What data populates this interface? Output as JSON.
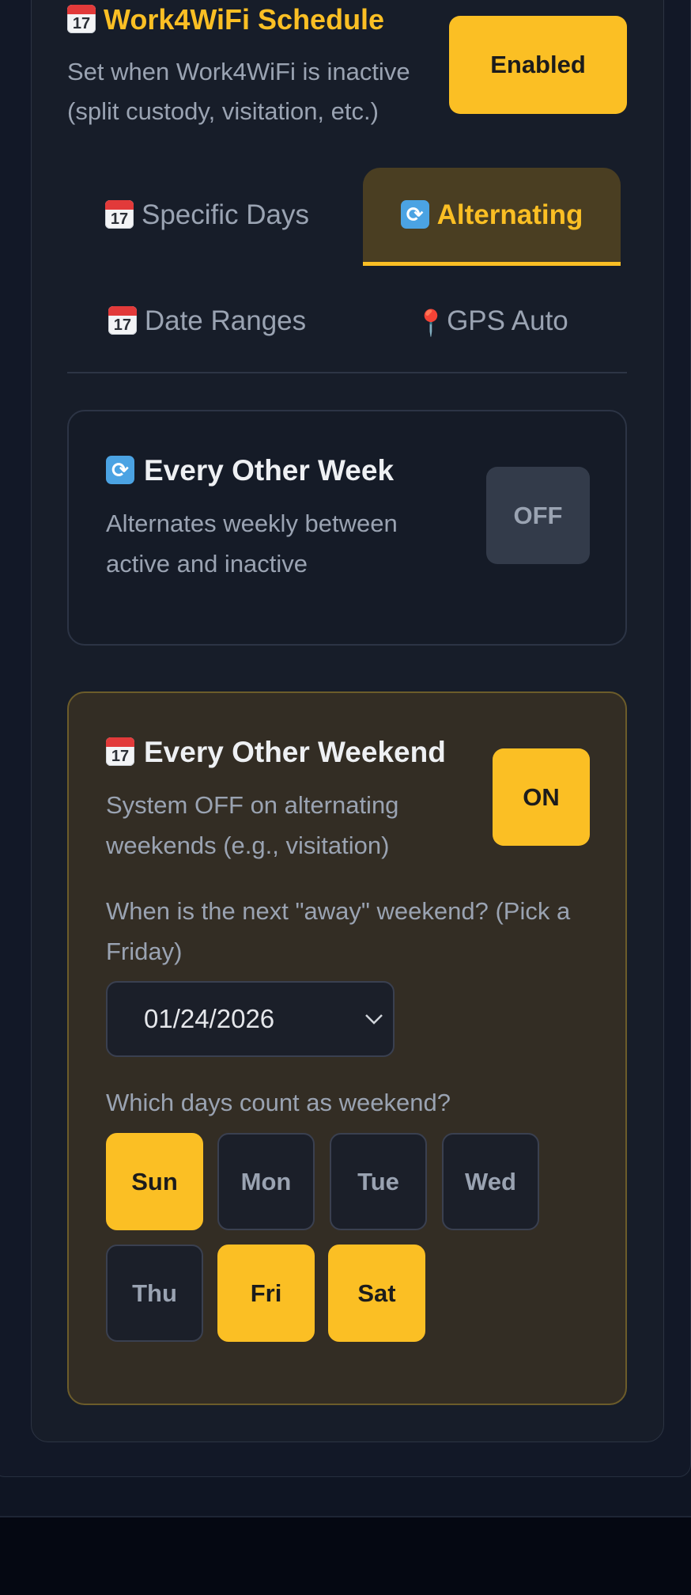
{
  "header": {
    "title": "Work4WiFi Schedule",
    "title_icon": "calendar-icon",
    "subtitle": "Set when Work4WiFi is inactive (split custody, visitation, etc.)",
    "status_button": "Enabled"
  },
  "tabs": [
    {
      "label": "Specific Days",
      "icon": "calendar-icon",
      "active": false
    },
    {
      "label": "Alternating",
      "icon": "sync-icon",
      "active": true
    },
    {
      "label": "Date Ranges",
      "icon": "calendar-icon",
      "active": false
    },
    {
      "label": "GPS Auto",
      "icon": "pin-icon",
      "active": false
    }
  ],
  "every_other_week": {
    "title": "Every Other Week",
    "icon": "sync-icon",
    "description": "Alternates weekly between active and inactive",
    "toggle": "OFF"
  },
  "every_other_weekend": {
    "title": "Every Other Weekend",
    "icon": "calendar-icon",
    "description": "System OFF on alternating weekends (e.g., visitation)",
    "toggle": "ON",
    "next_away_label": "When is the next \"away\" weekend? (Pick a Friday)",
    "next_away_value": "01/24/2026",
    "days_label": "Which days count as weekend?",
    "days": [
      {
        "label": "Sun",
        "selected": true
      },
      {
        "label": "Mon",
        "selected": false
      },
      {
        "label": "Tue",
        "selected": false
      },
      {
        "label": "Wed",
        "selected": false
      },
      {
        "label": "Thu",
        "selected": false
      },
      {
        "label": "Fri",
        "selected": true
      },
      {
        "label": "Sat",
        "selected": true
      }
    ]
  },
  "calendar_icon_text": "17",
  "colors": {
    "accent": "#fbbf24",
    "background": "#0f1523",
    "card": "#171d29",
    "active_card": "#332d24",
    "muted_text": "#9aa3b2"
  }
}
